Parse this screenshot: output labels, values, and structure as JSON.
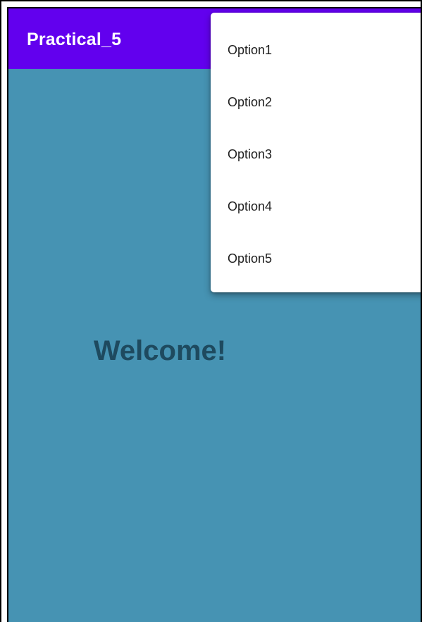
{
  "app_bar": {
    "title": "Practical_5",
    "color": "#6200ee"
  },
  "content": {
    "background_color": "#4693b3",
    "welcome_text": "Welcome!"
  },
  "overflow_menu": {
    "items": [
      {
        "label": "Option1"
      },
      {
        "label": "Option2"
      },
      {
        "label": "Option3"
      },
      {
        "label": "Option4"
      },
      {
        "label": "Option5"
      }
    ]
  }
}
